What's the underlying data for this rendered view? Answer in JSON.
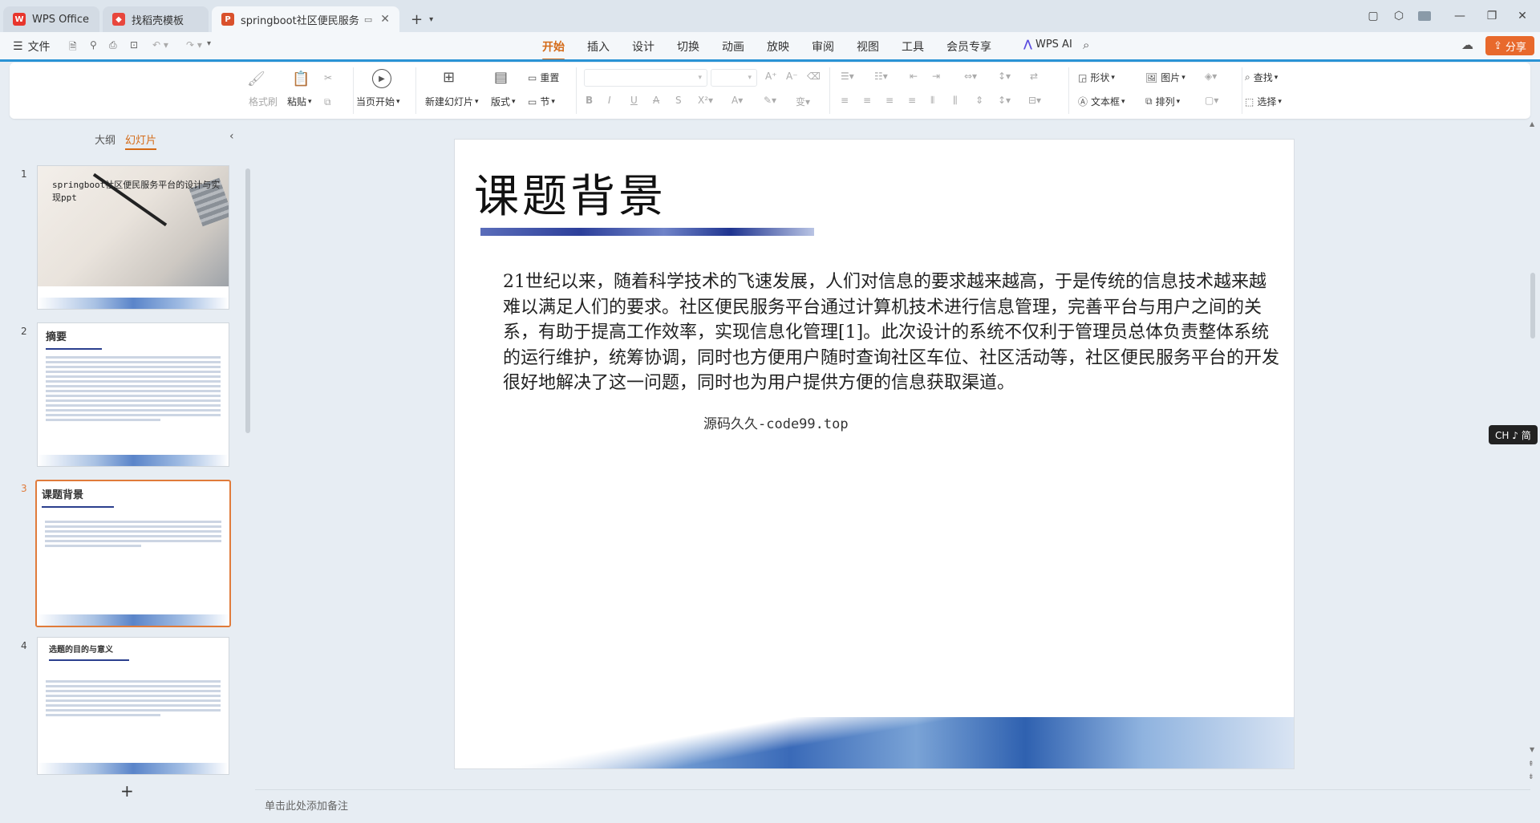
{
  "tabs": [
    {
      "label": "WPS Office",
      "icon": "wps-logo-icon"
    },
    {
      "label": "找稻壳模板",
      "icon": "docer-icon"
    },
    {
      "label": "springboot社区便民服务平",
      "icon": "ppt-icon"
    }
  ],
  "new_tab_label": "+",
  "menu": {
    "file": "文件",
    "tabs": [
      "开始",
      "插入",
      "设计",
      "切换",
      "动画",
      "放映",
      "审阅",
      "视图",
      "工具",
      "会员专享"
    ],
    "active_tab": "开始",
    "wps_ai": "WPS AI",
    "share": "分享"
  },
  "ribbon": {
    "format_painter": "格式刷",
    "paste": "粘贴",
    "play_from_current": "当页开始",
    "new_slide": "新建幻灯片",
    "layout": "版式",
    "reset": "重置",
    "section": "节",
    "shape": "形状",
    "picture": "图片",
    "textbox": "文本框",
    "arrange": "排列",
    "find": "查找",
    "select": "选择"
  },
  "panel": {
    "outline_tab": "大纲",
    "slides_tab": "幻灯片",
    "add_slide": "+"
  },
  "thumbnails": [
    {
      "num": "1",
      "title": "springboot社区便民服务平台的设计与实现ppt"
    },
    {
      "num": "2",
      "title": "摘要"
    },
    {
      "num": "3",
      "title": "课题背景"
    },
    {
      "num": "4",
      "title": "选题的目的与意义"
    }
  ],
  "slide": {
    "title": "课题背景",
    "body": "21世纪以来，随着科学技术的飞速发展，人们对信息的要求越来越高，于是传统的信息技术越来越难以满足人们的要求。社区便民服务平台通过计算机技术进行信息管理，完善平台与用户之间的关系，有助于提高工作效率，实现信息化管理[1]。此次设计的系统不仅利于管理员总体负责整体系统的运行维护，统筹协调，同时也方便用户随时查询社区车位、社区活动等，社区便民服务平台的开发很好地解决了这一问题，同时也为用户提供方便的信息获取渠道。",
    "watermark": "源码久久-code99.top"
  },
  "notes_placeholder": "单击此处添加备注",
  "ime_badge": "CH ♪ 简",
  "colors": {
    "accent": "#d46a17",
    "share_button": "#e8692c",
    "selection": "#e07b3a"
  }
}
